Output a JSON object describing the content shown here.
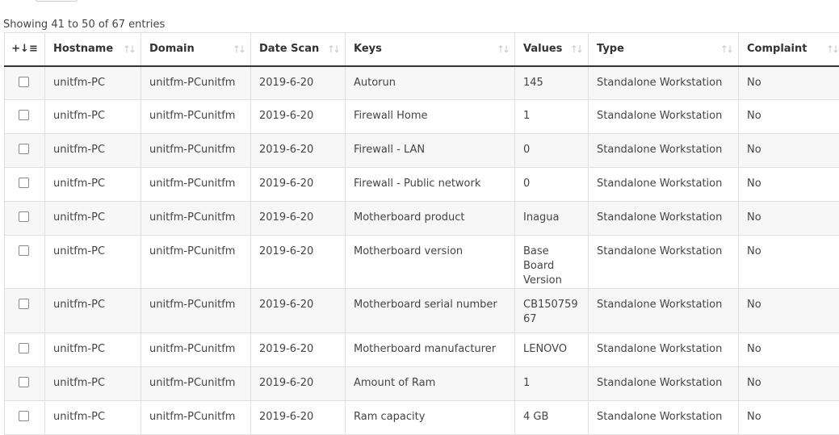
{
  "table_info": "Showing 41 to 50 of 67 entries",
  "columns": [
    {
      "label": "+"
    },
    {
      "label": "Hostname"
    },
    {
      "label": "Domain"
    },
    {
      "label": "Date Scan"
    },
    {
      "label": "Keys"
    },
    {
      "label": "Values"
    },
    {
      "label": "Type"
    },
    {
      "label": "Complaint"
    }
  ],
  "rows": [
    {
      "hostname": "unitfm-PC",
      "domain": "unitfm-PCunitfm",
      "date": "2019-6-20",
      "key": "Autorun",
      "value": "145",
      "type": "Standalone Workstation",
      "complaint": "No"
    },
    {
      "hostname": "unitfm-PC",
      "domain": "unitfm-PCunitfm",
      "date": "2019-6-20",
      "key": "Firewall Home",
      "value": "1",
      "type": "Standalone Workstation",
      "complaint": "No"
    },
    {
      "hostname": "unitfm-PC",
      "domain": "unitfm-PCunitfm",
      "date": "2019-6-20",
      "key": "Firewall - LAN",
      "value": "0",
      "type": "Standalone Workstation",
      "complaint": "No"
    },
    {
      "hostname": "unitfm-PC",
      "domain": "unitfm-PCunitfm",
      "date": "2019-6-20",
      "key": "Firewall - Public network",
      "value": "0",
      "type": "Standalone Workstation",
      "complaint": "No"
    },
    {
      "hostname": "unitfm-PC",
      "domain": "unitfm-PCunitfm",
      "date": "2019-6-20",
      "key": "Motherboard product",
      "value": "Inagua",
      "type": "Standalone Workstation",
      "complaint": "No"
    },
    {
      "hostname": "unitfm-PC",
      "domain": "unitfm-PCunitfm",
      "date": "2019-6-20",
      "key": "Motherboard version",
      "value": "Base Board Version",
      "type": "Standalone Workstation",
      "complaint": "No"
    },
    {
      "hostname": "unitfm-PC",
      "domain": "unitfm-PCunitfm",
      "date": "2019-6-20",
      "key": "Motherboard serial number",
      "value": "CB15075967",
      "type": "Standalone Workstation",
      "complaint": "No"
    },
    {
      "hostname": "unitfm-PC",
      "domain": "unitfm-PCunitfm",
      "date": "2019-6-20",
      "key": "Motherboard manufacturer",
      "value": "LENOVO",
      "type": "Standalone Workstation",
      "complaint": "No"
    },
    {
      "hostname": "unitfm-PC",
      "domain": "unitfm-PCunitfm",
      "date": "2019-6-20",
      "key": "Amount of Ram",
      "value": "1",
      "type": "Standalone Workstation",
      "complaint": "No"
    },
    {
      "hostname": "unitfm-PC",
      "domain": "unitfm-PCunitfm",
      "date": "2019-6-20",
      "key": "Ram capacity",
      "value": "4 GB",
      "type": "Standalone Workstation",
      "complaint": "No"
    }
  ]
}
